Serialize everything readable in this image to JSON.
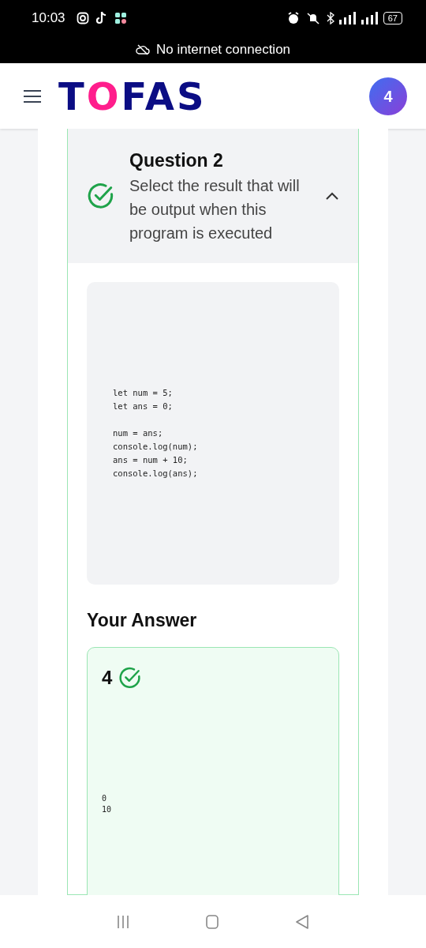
{
  "status_bar": {
    "time": "10:03",
    "battery": "67",
    "notice": "No internet connection"
  },
  "header": {
    "logo": "TOFAS",
    "avatar": "4"
  },
  "question": {
    "title": "Question 2",
    "prompt": "Select the result that will be output when this program is executed",
    "correct": true,
    "expanded": true,
    "code_blocks": [
      [
        "let num = 5;",
        "let ans = 0;"
      ],
      [
        "num = ans;",
        "console.log(num);",
        "ans = num + 10;",
        "console.log(ans);"
      ]
    ]
  },
  "answer": {
    "heading": "Your Answer",
    "value": "4",
    "correct": true,
    "output": [
      "0",
      "10"
    ]
  }
}
